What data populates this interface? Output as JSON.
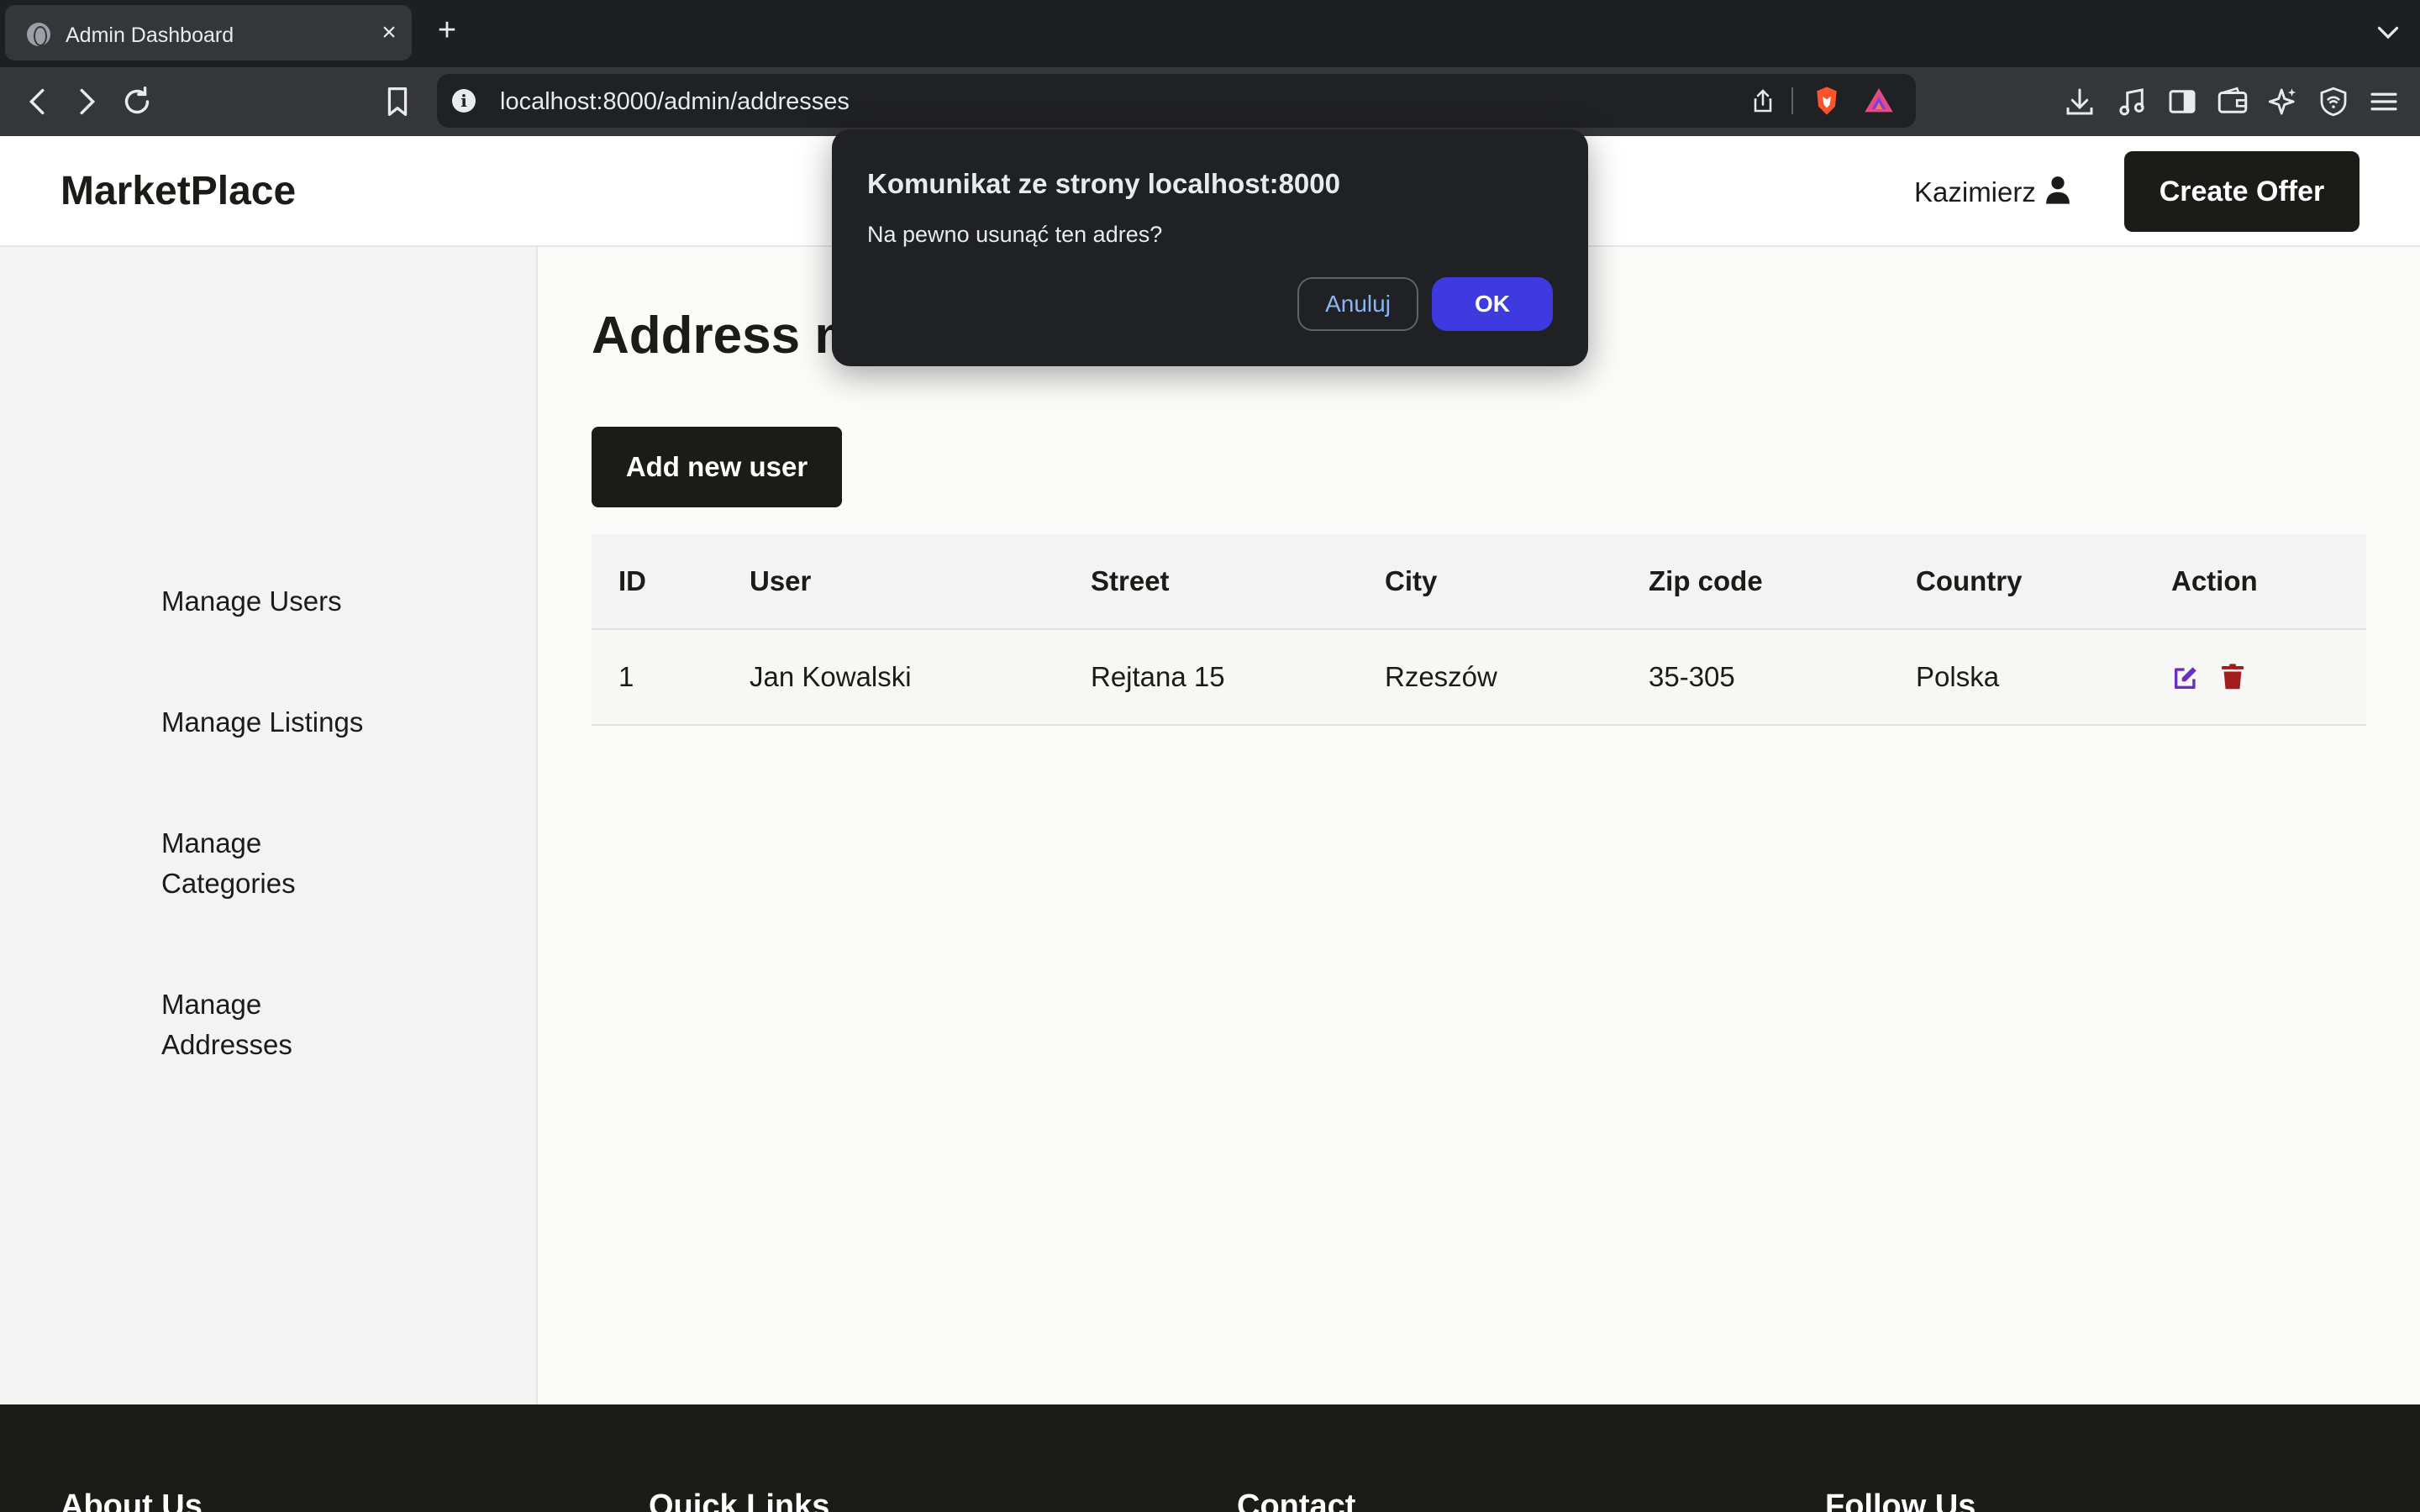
{
  "browser": {
    "tab_title": "Admin Dashboard",
    "tab_close": "×",
    "new_tab": "+",
    "url": "localhost:8000/admin/addresses",
    "info_glyph": "i"
  },
  "header": {
    "brand": "MarketPlace",
    "user_name": "Kazimierz",
    "create_offer_label": "Create Offer"
  },
  "sidebar": {
    "items": [
      {
        "label": "Manage Users"
      },
      {
        "label": "Manage Listings"
      },
      {
        "label": "Manage Categories"
      },
      {
        "label": "Manage Addresses"
      }
    ]
  },
  "main": {
    "title": "Address management",
    "add_button_label": "Add new user",
    "table": {
      "columns": [
        "ID",
        "User",
        "Street",
        "City",
        "Zip code",
        "Country",
        "Action"
      ],
      "rows": [
        [
          "1",
          "Jan Kowalski",
          "Rejtana 15",
          "Rzeszów",
          "35-305",
          "Polska"
        ]
      ]
    }
  },
  "footer": {
    "headings": [
      "About Us",
      "Quick Links",
      "Contact",
      "Follow Us"
    ]
  },
  "dialog": {
    "title": "Komunikat ze strony localhost:8000",
    "message": "Na pewno usunąć ten adres?",
    "cancel_label": "Anuluj",
    "ok_label": "OK"
  },
  "colors": {
    "dark": "#1b1b18",
    "edit_icon": "#6b2fbf",
    "delete_icon": "#a11d1d",
    "dialog_ok": "#3d3ae0"
  },
  "icons": [
    "globe-icon",
    "back-icon",
    "forward-icon",
    "reload-icon",
    "bookmark-icon",
    "info-icon",
    "share-icon",
    "brave-shield-icon",
    "brave-rewards-icon",
    "download-icon",
    "music-icon",
    "sidebar-icon",
    "wallet-icon",
    "leo-ai-icon",
    "vpn-icon",
    "menu-icon",
    "user-icon",
    "edit-icon",
    "trash-icon"
  ]
}
